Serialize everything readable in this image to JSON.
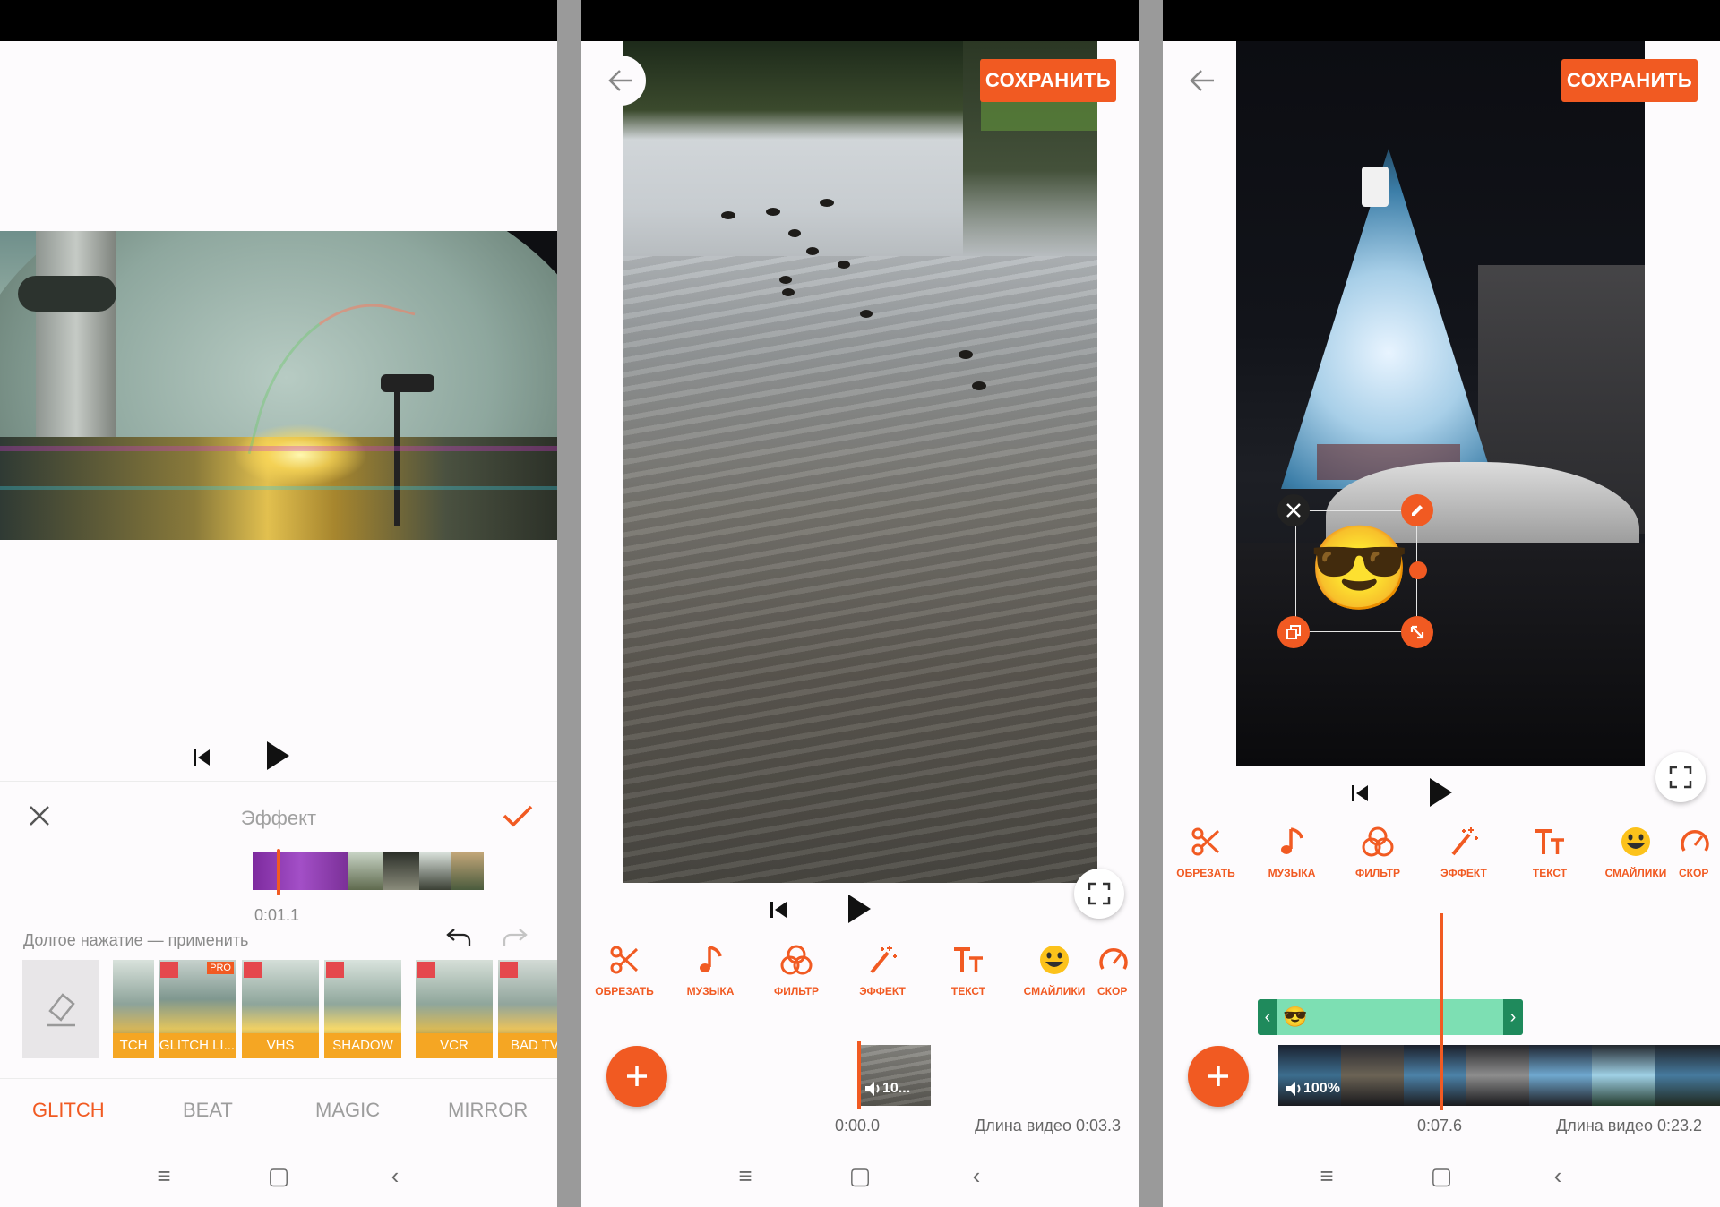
{
  "colors": {
    "accent": "#f15a22",
    "sticker_track": "#7ddfb3"
  },
  "screen1": {
    "effect_title": "Эффект",
    "timecode": "0:01.1",
    "hint": "Долгое нажатие — применить",
    "effects": [
      {
        "label": "TCH",
        "pro": false
      },
      {
        "label": "GLITCH LI...",
        "pro": true,
        "badge": "PRO"
      },
      {
        "label": "VHS",
        "pro": false
      },
      {
        "label": "SHADOW",
        "pro": false
      },
      {
        "label": "VCR",
        "pro": false
      },
      {
        "label": "BAD TV",
        "pro": false
      }
    ],
    "categories": [
      "GLITCH",
      "BEAT",
      "MAGIC",
      "MIRROR"
    ],
    "active_category": "GLITCH"
  },
  "screen2": {
    "save_label": "СОХРАНИТЬ",
    "tools": [
      "ОБРЕЗАТЬ",
      "МУЗЫКА",
      "ФИЛЬТР",
      "ЭФФЕКТ",
      "ТЕКСТ",
      "СМАЙЛИКИ",
      "СКОР"
    ],
    "clip_volume": "10...",
    "time_start": "0:00.0",
    "duration": "Длина видео 0:03.3"
  },
  "screen3": {
    "save_label": "СОХРАНИТЬ",
    "tools": [
      "ОБРЕЗАТЬ",
      "МУЗЫКА",
      "ФИЛЬТР",
      "ЭФФЕКТ",
      "ТЕКСТ",
      "СМАЙЛИКИ",
      "СКОР"
    ],
    "sticker_emoji": "😎",
    "clip_volume": "100%",
    "time_current": "0:07.6",
    "duration": "Длина видео 0:23.2"
  },
  "icons": [
    "back-arrow-icon",
    "fullscreen-icon",
    "skip-start-icon",
    "play-icon",
    "scissors-icon",
    "music-note-icon",
    "filter-icon",
    "magic-wand-icon",
    "text-icon",
    "smiley-icon",
    "speed-icon",
    "plus-icon",
    "close-icon",
    "check-icon",
    "undo-icon",
    "redo-icon",
    "eraser-icon",
    "menu-icon",
    "home-icon",
    "back-nav-icon",
    "volume-icon",
    "edit-icon",
    "copy-icon",
    "resize-icon"
  ]
}
